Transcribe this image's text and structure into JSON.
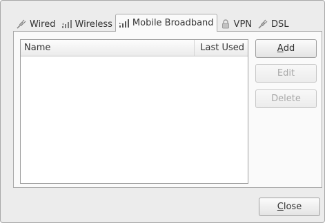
{
  "tabs": [
    {
      "label": "Wired",
      "icon": "ethernet-plug-icon",
      "active": false
    },
    {
      "label": "Wireless",
      "icon": "wifi-signal-icon",
      "active": false
    },
    {
      "label": "Mobile Broadband",
      "icon": "mobile-signal-icon",
      "active": true
    },
    {
      "label": "VPN",
      "icon": "lock-icon",
      "active": false
    },
    {
      "label": "DSL",
      "icon": "ethernet-plug-icon",
      "active": false
    }
  ],
  "list": {
    "columns": [
      "Name",
      "Last Used"
    ],
    "rows": []
  },
  "buttons": {
    "add_mnemonic": "A",
    "add_rest": "dd",
    "edit": "Edit",
    "delete": "Delete",
    "close_mnemonic": "C",
    "close_rest": "lose"
  },
  "colors": {
    "dialog_bg": "#ececec",
    "page_bg": "#fafafa",
    "disabled_text": "#a8a8a8"
  }
}
